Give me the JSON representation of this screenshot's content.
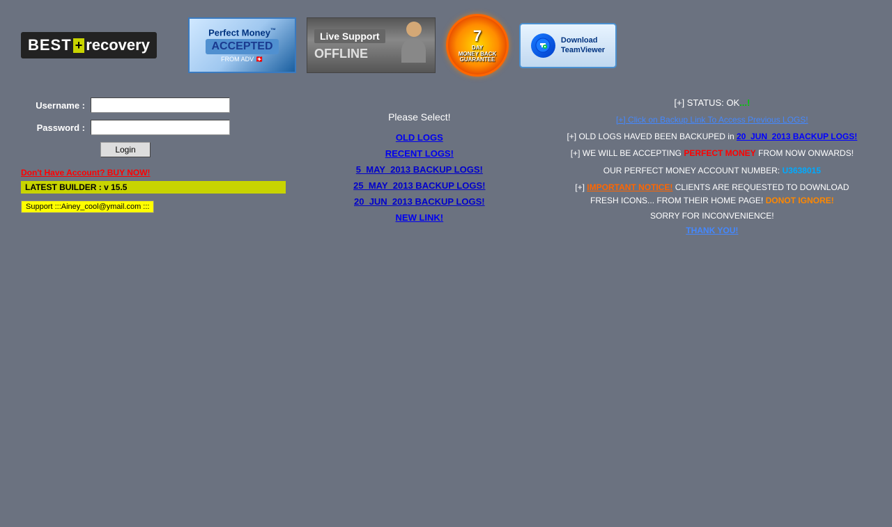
{
  "logo": {
    "best": "BEST",
    "plus": "+",
    "recovery": "recovery"
  },
  "perfect_money": {
    "title": "Perfect Money",
    "tm": "™",
    "accepted": "ACCEPTED",
    "from": "FROM ADV"
  },
  "live_support": {
    "title": "Live Support",
    "status": "OFFLINE"
  },
  "money_back": {
    "days": "7",
    "day_label": "DAY",
    "line2": "MONEY BACK",
    "line3": "GUARANTEE"
  },
  "teamviewer": {
    "line1": "Download",
    "line2": "TeamViewer"
  },
  "form": {
    "username_label": "Username :",
    "password_label": "Password :",
    "username_placeholder": "",
    "password_placeholder": "",
    "login_button": "Login"
  },
  "links": {
    "buy_now": "Don't Have Account? BUY NOW!",
    "latest_builder": "LATEST BUILDER : v 15.5",
    "support": "Support :::Ainey_cool@ymail.com :::"
  },
  "middle": {
    "please_select": "Please Select!",
    "old_logs": "OLD LOGS",
    "recent_logs": "RECENT LOGS!",
    "backup_5may": "5_MAY_2013 BACKUP LOGS!",
    "backup_25may": "25_MAY_2013 BACKUP LOGS!",
    "backup_20jun": "20_JUN_2013 BACKUP LOGS!",
    "new_link": "NEW LINK!"
  },
  "right": {
    "status_prefix": "[+] STATUS: OK",
    "status_dots": "...!",
    "backup_notice_prefix": "[+] Click on Backup Link To Access Previous LOGS!",
    "old_logs_notice": "[+] OLD LOGS HAVED BEEN BACKUPED in",
    "backup_logs_link": "20_JUN_2013 BACKUP LOGS!",
    "accepting_prefix": "[+] WE WILL BE ACCEPTING",
    "perfect_money_word": "PERFECT MONEY",
    "accepting_suffix": "FROM  NOW ONWARDS!",
    "account_prefix": "OUR PERFECT MONEY ACCOUNT NUMBER:",
    "account_number": "U3638015",
    "important_prefix": "[+]",
    "important_word": "IMPORTANT NOTICE!",
    "important_msg": "CLIENTS ARE REQUESTED TO DOWNLOAD FRESH ICONS... FROM THEIR HOME PAGE!",
    "donot_ignore": "DONOT IGNORE!",
    "sorry": "SORRY FOR INCONVENIENCE!",
    "thank_you": "THANK YOU!"
  }
}
